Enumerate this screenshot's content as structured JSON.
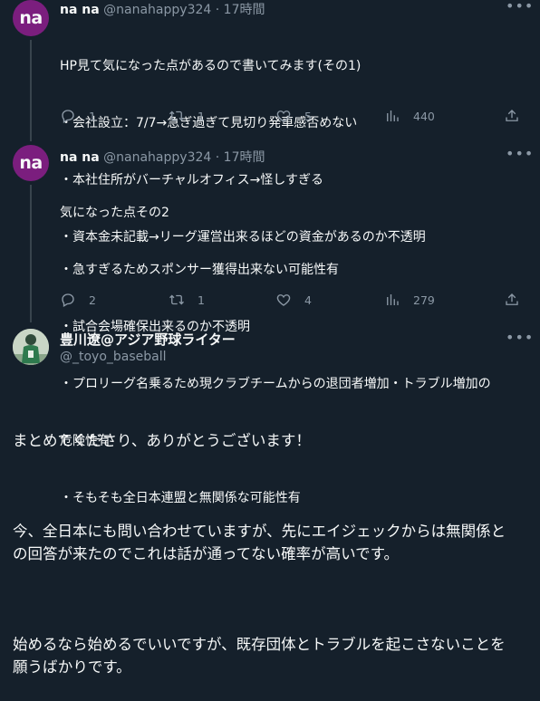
{
  "tweets": [
    {
      "avatar_text": "na",
      "display_name": "na na",
      "handle": "@nanahappy324",
      "separator": "·",
      "time": "17時間",
      "lines": [
        "HP見て気になった点があるので書いてみます(その1)",
        "・会社設立：7/7→急ぎ過ぎて見切り発車感否めない",
        "・本社住所がバーチャルオフィス→怪しすぎる",
        "・資本金未記載→リーグ運営出来るほどの資金があるのか不透明"
      ],
      "reply_count": "1",
      "retweet_count": "1",
      "like_count": "5",
      "view_count": "440"
    },
    {
      "avatar_text": "na",
      "display_name": "na na",
      "handle": "@nanahappy324",
      "separator": "·",
      "time": "17時間",
      "lines": [
        "気になった点その2",
        "・急すぎるためスポンサー獲得出来ない可能性有",
        "・試合会場確保出来るのか不透明",
        "・プロリーグ名乗るため現クラブチームからの退団者増加・トラブル増加の",
        "危険性有",
        "・そもそも全日本連盟と無関係な可能性有"
      ],
      "reply_count": "2",
      "retweet_count": "1",
      "like_count": "4",
      "view_count": "279"
    }
  ],
  "focus": {
    "display_name": "豊川遼@アジア野球ライター",
    "handle": "@_toyo_baseball",
    "paragraphs": [
      "まとめてくださり、ありがとうございます！",
      "今、全日本にも問い合わせていますが、先にエイジェックからは無関係と\nの回答が来たのでこれは話が通ってない確率が高いです。",
      "始めるなら始めるでいいですが、既存団体とトラブルを起こさないことを\n願うばかりです。"
    ]
  },
  "colors": {
    "background": "#15202b",
    "text": "#f7f9f9",
    "secondary": "#8b98a5",
    "avatar": "#7b1e7e"
  },
  "icons": [
    "reply-icon",
    "retweet-icon",
    "like-icon",
    "views-icon",
    "share-icon",
    "more-icon"
  ]
}
